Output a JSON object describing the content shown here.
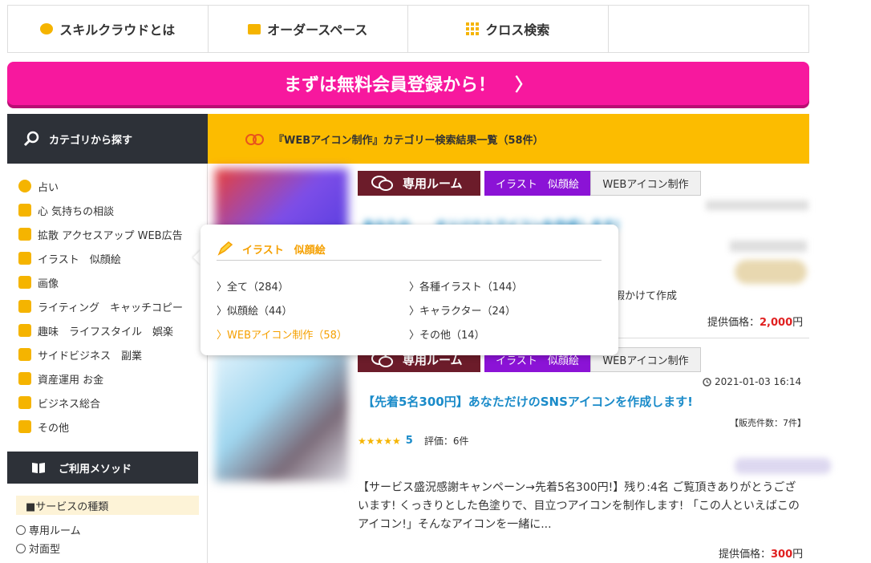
{
  "nav": {
    "items": [
      {
        "label": "スキルクラウドとは",
        "icon": "chat-bubble-icon"
      },
      {
        "label": "オーダースペース",
        "icon": "speech-icon"
      },
      {
        "label": "クロス検索",
        "icon": "grid-icon"
      }
    ]
  },
  "register": {
    "label": "まずは無料会員登録から！",
    "arrow": "〉"
  },
  "sidebar": {
    "title": "カテゴリから探す",
    "categories": [
      "占い",
      "心 気持ちの相談",
      "拡散 アクセスアップ WEB広告",
      "イラスト　似顔絵",
      "画像",
      "ライティング　キャッチコピー",
      "趣味　ライフスタイル　娯楽",
      "サイドビジネス　副業",
      "資産運用 お金",
      "ビジネス総合",
      "その他"
    ],
    "method_title": "ご利用メソッド",
    "service_type_label": "■サービスの種類",
    "service_types": [
      "専用ルーム",
      "対面型"
    ]
  },
  "results": {
    "header": "『WEBアイコン制作』カテゴリー検索結果一覧（58件）"
  },
  "cards": [
    {
      "room_label": "専用ルーム",
      "category": "イラスト　似顔絵",
      "subcategory": "WEBアイコン制作",
      "title_partial": "あなたの　　オリジナルアイコンを作成します!",
      "snippet": "暇かけて作成",
      "price_label": "提供価格：",
      "price": "2,000",
      "price_unit": "円"
    },
    {
      "room_label": "専用ルーム",
      "category": "イラスト　似顔絵",
      "subcategory": "WEBアイコン制作",
      "date": "2021-01-03 16:14",
      "title": "【先着5名300円】あなただけのSNSアイコンを作成します!",
      "sales": "【販売件数：7件】",
      "stars": "★★★★★",
      "rating": "5",
      "review_label": "評価：",
      "review_count": "6件",
      "description": "【サービス盛況感謝キャンペーン→先着5名300円!】残り:4名 ご覧頂きありがとうございます! くっきりとした色塗りで、目立つアイコンを制作します! 「この人といえばこのアイコン!」そんなアイコンを一緒に...",
      "price_label": "提供価格：",
      "price": "300",
      "price_unit": "円"
    }
  ],
  "popup": {
    "title": "イラスト　似顔絵",
    "links_left": [
      "全て（284）",
      "似顔絵（44）",
      "WEBアイコン制作（58）"
    ],
    "links_right": [
      "各種イラスト（144）",
      "キャラクター（24）",
      "その他（14）"
    ]
  }
}
